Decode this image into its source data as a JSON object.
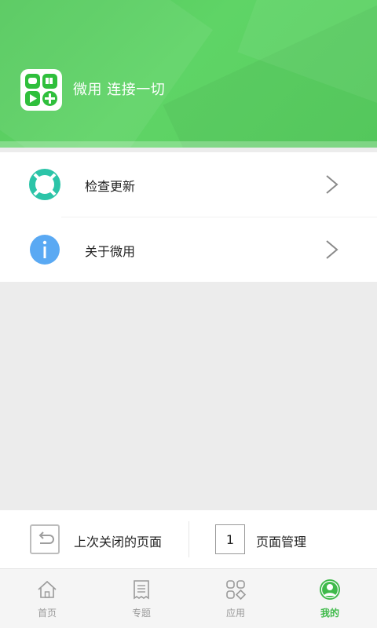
{
  "header": {
    "slogan": "微用 连接一切",
    "brand_color": "#5ad163",
    "logo_icon": "app-logo-grid-icon"
  },
  "menu": {
    "items": [
      {
        "label": "检查更新",
        "icon": "lifebuoy-icon",
        "icon_color": "#2cc4a8"
      },
      {
        "label": "关于微用",
        "icon": "info-icon",
        "icon_color": "#5aa9f3"
      }
    ]
  },
  "page_bar": {
    "last_closed_label": "上次关闭的页面",
    "page_count": "1",
    "page_manage_label": "页面管理"
  },
  "tabbar": {
    "active_color": "#3fba4a",
    "items": [
      {
        "label": "首页",
        "icon": "home-icon",
        "active": false
      },
      {
        "label": "专题",
        "icon": "document-icon",
        "active": false
      },
      {
        "label": "应用",
        "icon": "apps-icon",
        "active": false
      },
      {
        "label": "我的",
        "icon": "profile-icon",
        "active": true
      }
    ]
  }
}
